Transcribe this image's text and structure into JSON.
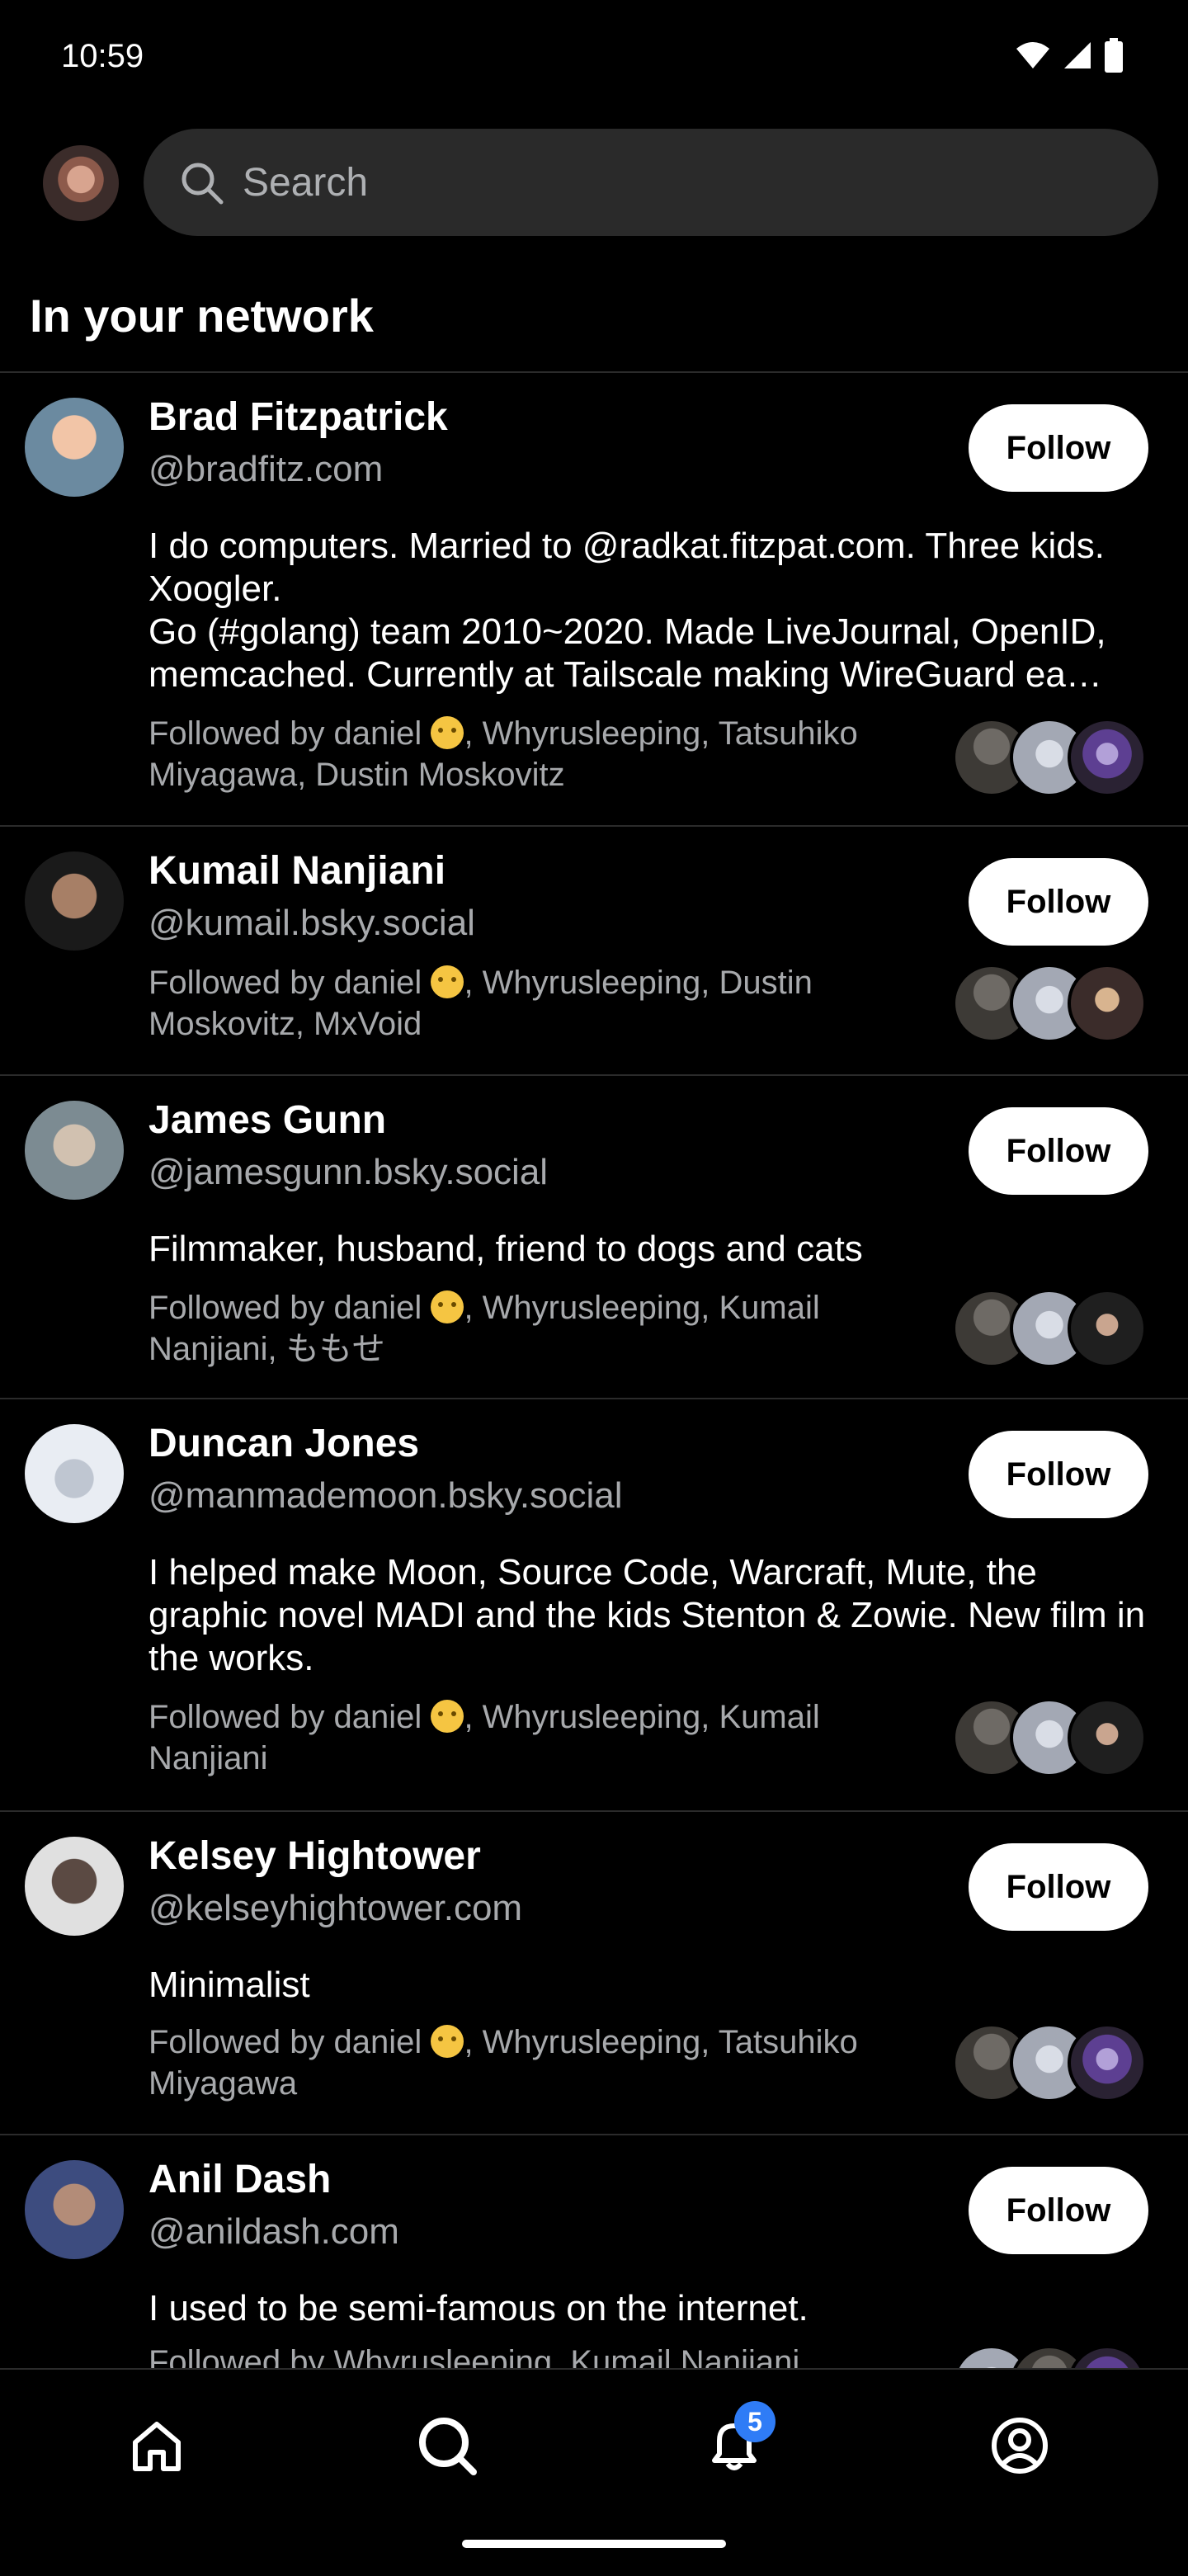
{
  "status_bar": {
    "time": "10:59"
  },
  "header": {
    "search_placeholder": "Search"
  },
  "section": {
    "title": "In your network"
  },
  "users": [
    {
      "name": "Brad Fitzpatrick",
      "handle": "@bradfitz.com",
      "follow_label": "Follow",
      "bio": "I do computers. Married to @radkat.fitzpat.com. Three kids. Xoogler.\nGo (#golang) team 2010~2020. Made LiveJournal, OpenID, memcached. Currently at Tailscale making WireGuard ea…",
      "followed_prefix": "Followed by daniel",
      "followed_rest": ", Whyrusleeping, Tatsuhiko Miyagawa, Dustin Moskovitz"
    },
    {
      "name": "Kumail Nanjiani",
      "handle": "@kumail.bsky.social",
      "follow_label": "Follow",
      "bio": "",
      "followed_prefix": "Followed by daniel",
      "followed_rest": ", Whyrusleeping, Dustin Moskovitz, MxVoid"
    },
    {
      "name": "James Gunn",
      "handle": "@jamesgunn.bsky.social",
      "follow_label": "Follow",
      "bio": "Filmmaker, husband, friend to dogs and cats",
      "followed_prefix": "Followed by daniel",
      "followed_rest": ", Whyrusleeping, Kumail Nanjiani, ももせ"
    },
    {
      "name": "Duncan Jones",
      "handle": "@manmademoon.bsky.social",
      "follow_label": "Follow",
      "bio": "I helped make Moon, Source Code, Warcraft, Mute, the graphic novel MADI and the kids Stenton & Zowie. New film in the works.",
      "followed_prefix": "Followed by daniel",
      "followed_rest": ", Whyrusleeping, Kumail Nanjiani"
    },
    {
      "name": "Kelsey Hightower",
      "handle": "@kelseyhightower.com",
      "follow_label": "Follow",
      "bio": "Minimalist",
      "followed_prefix": "Followed by daniel",
      "followed_rest": ", Whyrusleeping, Tatsuhiko Miyagawa"
    },
    {
      "name": "Anil Dash",
      "handle": "@anildash.com",
      "follow_label": "Follow",
      "bio": "I used to be semi-famous on the internet.",
      "followed_prefix": "Followed by Whyrusleeping, Kumail Nanjiani",
      "followed_rest": ""
    }
  ],
  "bottom_nav": {
    "notifications_badge": "5"
  },
  "icons": {
    "home": "home-icon",
    "search": "search-icon",
    "notifications": "bell-icon",
    "profile": "profile-icon"
  },
  "colors": {
    "background": "#000000",
    "badge": "#2f7cf6",
    "secondary_text": "#a7a9ac"
  }
}
